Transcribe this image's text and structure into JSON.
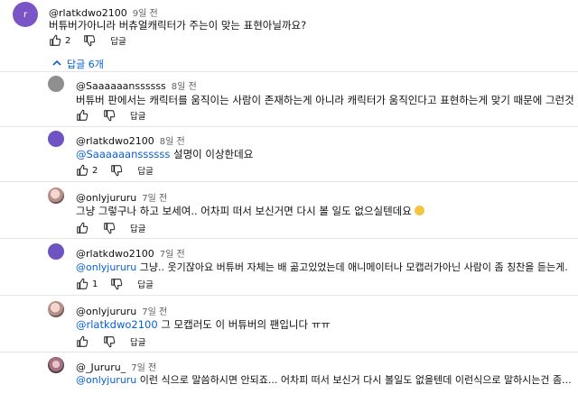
{
  "top_comment": {
    "author": "@rlatkdwo2100",
    "time": "9일 전",
    "text": "버튜버가아니라 버츄얼캐릭터가 주는이 맞는 표현아닐까요?",
    "likes": "2",
    "reply_label": "답글"
  },
  "replies_toggle": "답글 6개",
  "replies": [
    {
      "author": "@Saaaaaanssssss",
      "time": "8일 전",
      "mention": "",
      "text": "버튜버 판에서는 캐릭터를 움직이는 사람이 존재하는게 아니라 캐릭터가 움직인다고 표현하는게 맞기 때문에 그런것 입니다",
      "likes": "",
      "reply_label": "답글"
    },
    {
      "author": "@rlatkdwo2100",
      "time": "8일 전",
      "mention": "@Saaaaaanssssss",
      "text": " 설명이 이상한데요",
      "likes": "2",
      "reply_label": "답글"
    },
    {
      "author": "@onlyjururu",
      "time": "7일 전",
      "mention": "",
      "text": "그냥 그렇구나 하고 보세여.. 어차피 떠서 보신거면 다시 볼 일도 없으실텐데요",
      "likes": "",
      "reply_label": "답글"
    },
    {
      "author": "@rlatkdwo2100",
      "time": "7일 전",
      "mention": "@onlyjururu",
      "text": " 그냥.. 웃기잖아요 버튜버 자체는 배 곪고있었는데 애니메이터나 모캡러가아닌 사람이 좀 칭찬을 듣는게.",
      "likes": "1",
      "reply_label": "답글"
    },
    {
      "author": "@onlyjururu",
      "time": "7일 전",
      "mention": "@rlatkdwo2100",
      "text": " 그 모캡러도 이 버튜버의 팬입니다 ㅠㅠ",
      "likes": "",
      "reply_label": "답글"
    },
    {
      "author": "@_Jururu_",
      "time": "7일 전",
      "mention": "@onlyjururu",
      "text": " 이런 식으로 말씀하시면 안되죠... 어차피 떠서 보신거 다시 볼일도 없을텐데 이런식으로 말하시는건 좀...",
      "likes": "",
      "reply_label": ""
    }
  ],
  "colors": {
    "link": "#065fd4",
    "text": "#0f0f0f",
    "muted": "#606060"
  }
}
